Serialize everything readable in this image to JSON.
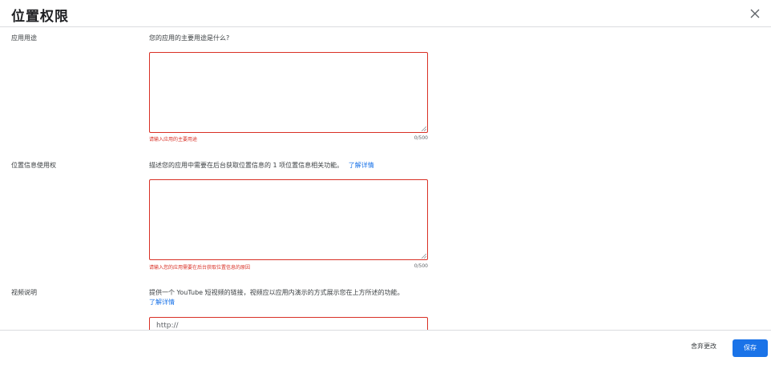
{
  "dialog": {
    "title": "位置权限",
    "close_icon": "close-icon"
  },
  "sections": {
    "purpose": {
      "label": "应用用途",
      "question": "您的应用的主要用途是什么?",
      "textarea_value": "",
      "error": "请输入应用的主要用途",
      "count": "0/500"
    },
    "location_usage": {
      "label": "位置信息使用权",
      "question": "描述您的应用中需要在后台获取位置信息的 1 项位置信息相关功能。",
      "learn_more": "了解详情",
      "textarea_value": "",
      "error": "请输入您的应用需要在后台获取位置信息的原因",
      "count": "0/500"
    },
    "video": {
      "label": "视频说明",
      "question": "提供一个 YouTube 短视频的链接，视频应以应用内演示的方式展示您在上方所述的功能。",
      "learn_more": "了解详情",
      "url_value": "http://"
    }
  },
  "footer": {
    "discard_label": "舍弃更改",
    "save_label": "保存"
  },
  "colors": {
    "accent": "#1a73e8",
    "error": "#d93025",
    "divider": "#dadce0"
  }
}
